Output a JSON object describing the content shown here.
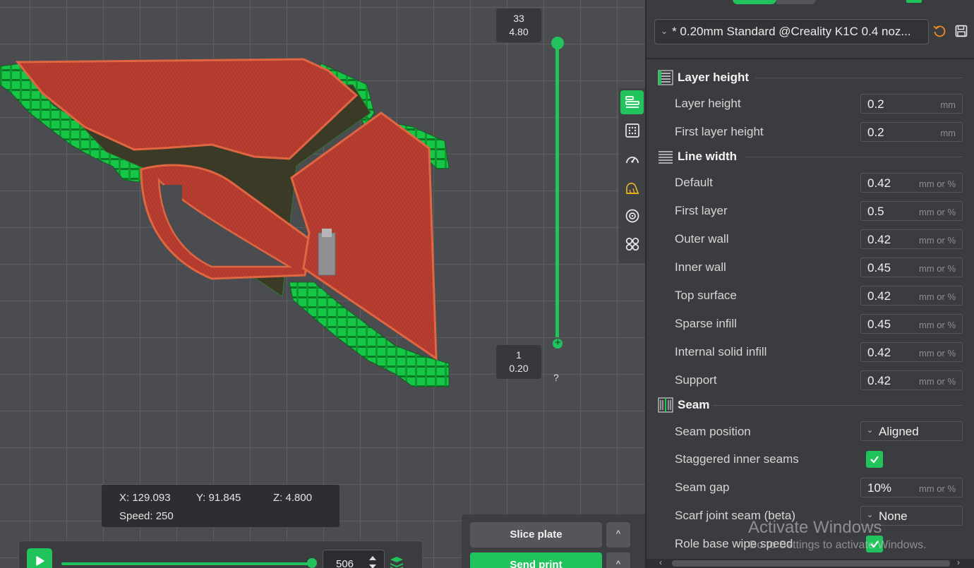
{
  "layer_slider": {
    "top_layer": "33",
    "top_height": "4.80",
    "bottom_layer": "1",
    "bottom_height": "0.20",
    "help": "?"
  },
  "readout": {
    "x": "X: 129.093",
    "y": "Y: 91.845",
    "z": "Z: 4.800",
    "speed": "Speed: 250"
  },
  "playback": {
    "move_value": "506",
    "progress_fraction": 1.0
  },
  "actions": {
    "slice_label": "Slice plate",
    "send_label": "Send print",
    "caret": "^"
  },
  "side_toolbar": {
    "items": [
      "layers-icon",
      "supports-icon",
      "speed-icon",
      "seam-icon",
      "filament-icon",
      "other-icon"
    ],
    "active": "layers-icon"
  },
  "preset": {
    "name": "* 0.20mm Standard @Creality K1C 0.4 noz..."
  },
  "settings": {
    "layer_height": {
      "title": "Layer height",
      "rows": [
        {
          "label": "Layer height",
          "value": "0.2",
          "unit": "mm"
        },
        {
          "label": "First layer height",
          "value": "0.2",
          "unit": "mm"
        }
      ]
    },
    "line_width": {
      "title": "Line width",
      "rows": [
        {
          "label": "Default",
          "value": "0.42",
          "unit": "mm or %"
        },
        {
          "label": "First layer",
          "value": "0.5",
          "unit": "mm or %"
        },
        {
          "label": "Outer wall",
          "value": "0.42",
          "unit": "mm or %"
        },
        {
          "label": "Inner wall",
          "value": "0.45",
          "unit": "mm or %"
        },
        {
          "label": "Top surface",
          "value": "0.42",
          "unit": "mm or %"
        },
        {
          "label": "Sparse infill",
          "value": "0.45",
          "unit": "mm or %"
        },
        {
          "label": "Internal solid infill",
          "value": "0.42",
          "unit": "mm or %"
        },
        {
          "label": "Support",
          "value": "0.42",
          "unit": "mm or %"
        }
      ]
    },
    "seam": {
      "title": "Seam",
      "seam_position": {
        "label": "Seam position",
        "value": "Aligned"
      },
      "staggered": {
        "label": "Staggered inner seams",
        "checked": true
      },
      "seam_gap": {
        "label": "Seam gap",
        "value": "10%",
        "unit": "mm or %"
      },
      "scarf": {
        "label": "Scarf joint seam (beta)",
        "value": "None"
      },
      "role_wipe": {
        "label": "Role base wipe speed",
        "checked": true
      }
    }
  },
  "watermark": {
    "line1": "Activate Windows",
    "line2": "Go to Settings to activate Windows."
  },
  "colors": {
    "accent": "#21c35c",
    "model_red": "#b8352b",
    "support_green": "#19d24a"
  }
}
